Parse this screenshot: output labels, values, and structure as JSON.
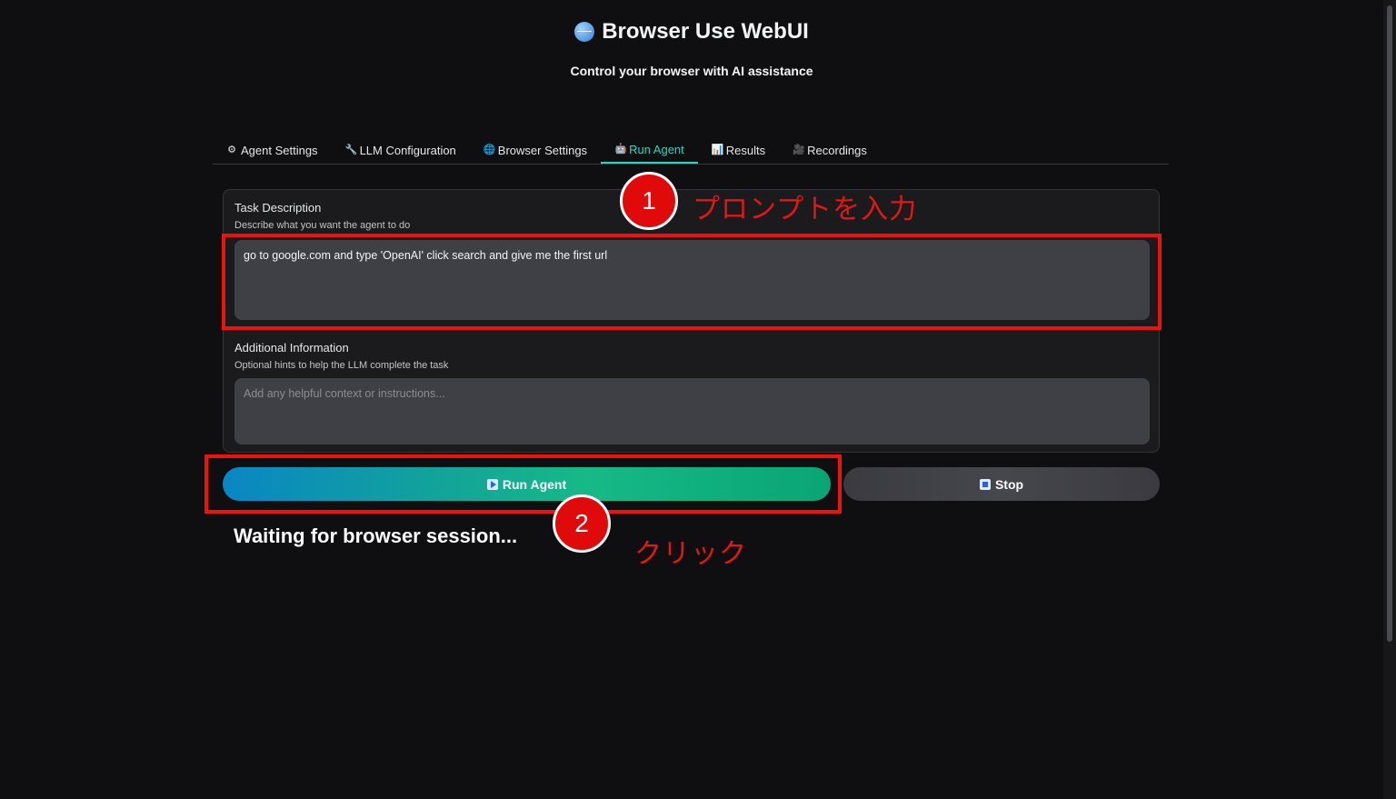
{
  "header": {
    "title": "Browser Use WebUI",
    "subtitle": "Control your browser with AI assistance"
  },
  "tabs": [
    {
      "label": "Agent Settings",
      "icon": "gear-icon"
    },
    {
      "label": "LLM Configuration",
      "icon": "wrench-icon"
    },
    {
      "label": "Browser Settings",
      "icon": "globe-icon"
    },
    {
      "label": "Run Agent",
      "icon": "robot-icon",
      "active": true
    },
    {
      "label": "Results",
      "icon": "chart-icon"
    },
    {
      "label": "Recordings",
      "icon": "film-icon"
    }
  ],
  "task": {
    "label": "Task Description",
    "hint": "Describe what you want the agent to do",
    "value": "go to google.com and type 'OpenAI' click search and give me the first url"
  },
  "additional": {
    "label": "Additional Information",
    "hint": "Optional hints to help the LLM complete the task",
    "placeholder": "Add any helpful context or instructions..."
  },
  "buttons": {
    "run": "Run Agent",
    "stop": "Stop"
  },
  "status": "Waiting for browser session...",
  "annotations": {
    "marker1": "1",
    "text1": "プロンプトを入力",
    "marker2": "2",
    "text2": "クリック",
    "color": "#e10a0a"
  }
}
